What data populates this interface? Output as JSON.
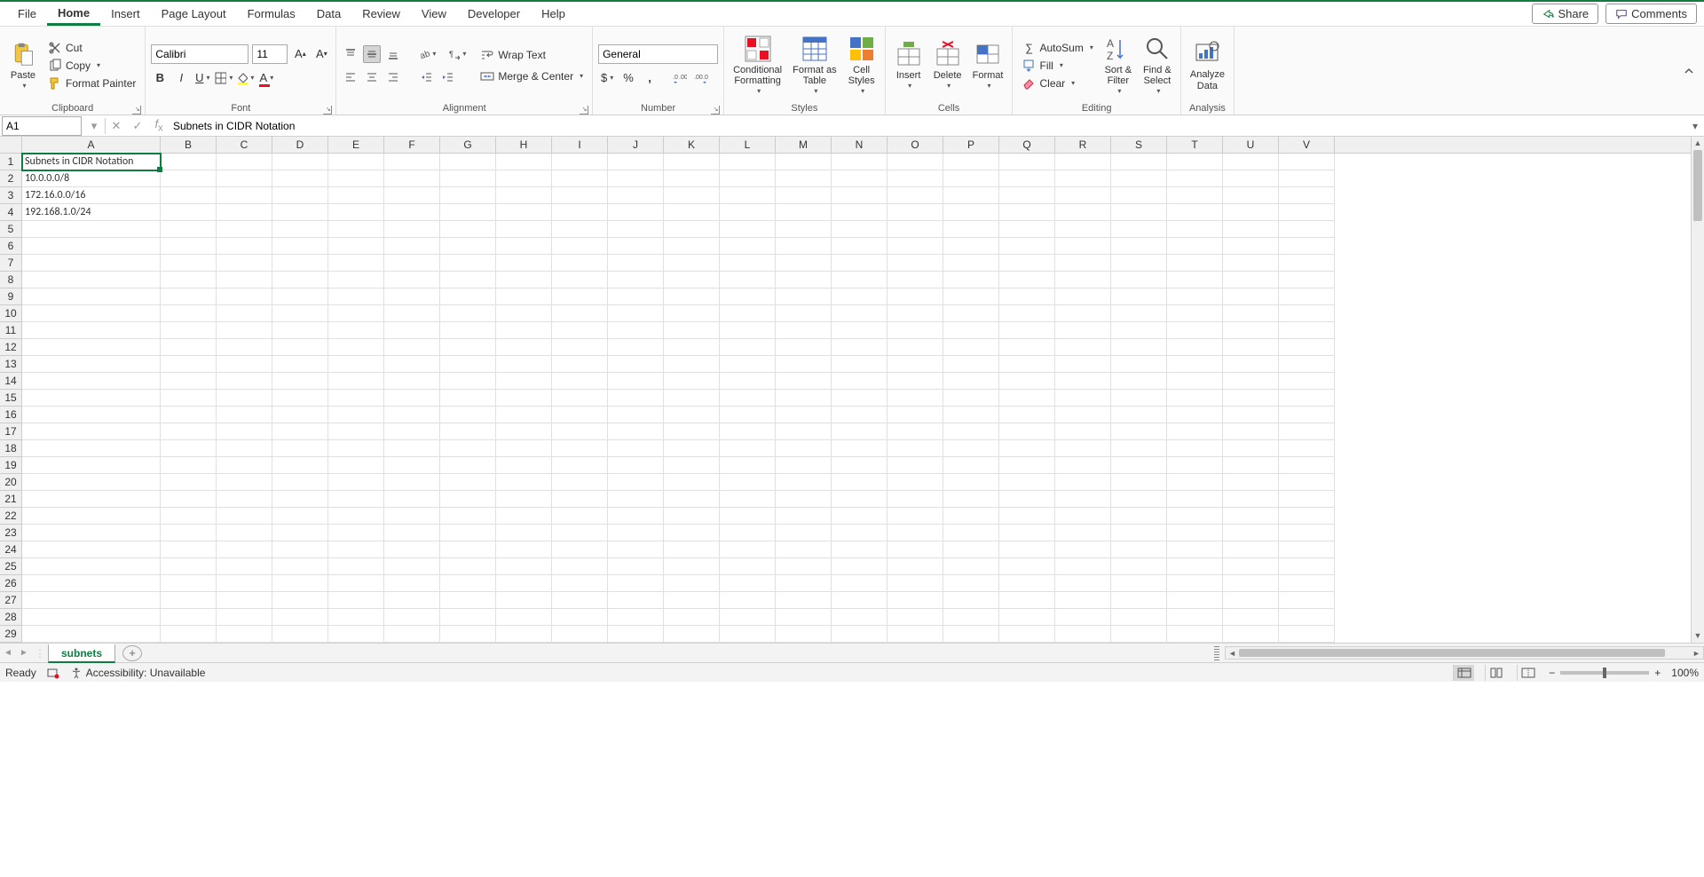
{
  "tabs": [
    "File",
    "Home",
    "Insert",
    "Page Layout",
    "Formulas",
    "Data",
    "Review",
    "View",
    "Developer",
    "Help"
  ],
  "active_tab": "Home",
  "share": "Share",
  "comments": "Comments",
  "clipboard": {
    "label": "Clipboard",
    "paste": "Paste",
    "cut": "Cut",
    "copy": "Copy",
    "format_painter": "Format Painter"
  },
  "font": {
    "label": "Font",
    "name": "Calibri",
    "size": "11"
  },
  "alignment": {
    "label": "Alignment",
    "wrap": "Wrap Text",
    "merge": "Merge & Center"
  },
  "number": {
    "label": "Number",
    "format": "General"
  },
  "styles": {
    "label": "Styles",
    "cond": "Conditional\nFormatting",
    "table": "Format as\nTable",
    "cell": "Cell\nStyles"
  },
  "cells_group": {
    "label": "Cells",
    "insert": "Insert",
    "delete": "Delete",
    "format": "Format"
  },
  "editing": {
    "label": "Editing",
    "autosum": "AutoSum",
    "fill": "Fill",
    "clear": "Clear",
    "sort": "Sort &\nFilter",
    "find": "Find &\nSelect"
  },
  "analysis": {
    "label": "Analysis",
    "analyze": "Analyze\nData"
  },
  "namebox": "A1",
  "formula": "Subnets in CIDR Notation",
  "columns": [
    "A",
    "B",
    "C",
    "D",
    "E",
    "F",
    "G",
    "H",
    "I",
    "J",
    "K",
    "L",
    "M",
    "N",
    "O",
    "P",
    "Q",
    "R",
    "S",
    "T",
    "U",
    "V"
  ],
  "rows": 29,
  "celldata": {
    "A1": "Subnets in CIDR Notation",
    "A2": "10.0.0.0/8",
    "A3": "172.16.0.0/16",
    "A4": "192.168.1.0/24"
  },
  "selected": "A1",
  "sheet_tab": "subnets",
  "status": {
    "ready": "Ready",
    "accessibility": "Accessibility: Unavailable",
    "zoom": "100%"
  }
}
